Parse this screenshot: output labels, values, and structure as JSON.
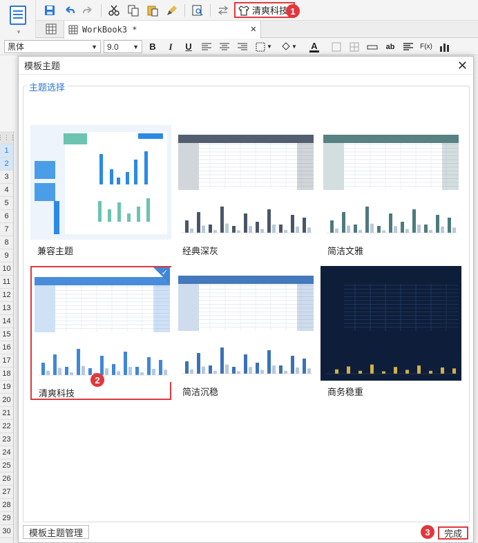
{
  "toolbar": {
    "theme_button_label": "清爽科技",
    "badge1": "1",
    "badge2": "2",
    "badge3": "3"
  },
  "tabs": {
    "workbook_tab": "WorkBook3 *"
  },
  "format_bar": {
    "font_value": "黑体",
    "size_value": "9.0",
    "bold": "B",
    "italic": "I",
    "underline": "U",
    "ab": "ab",
    "fx": "F(x)"
  },
  "rows": [
    "1",
    "2",
    "3",
    "4",
    "5",
    "6",
    "7",
    "8",
    "9",
    "10",
    "11",
    "12",
    "13",
    "14",
    "15",
    "16",
    "17",
    "18",
    "19",
    "20",
    "21",
    "22",
    "23",
    "24",
    "25",
    "26",
    "27",
    "28",
    "29",
    "30"
  ],
  "dialog": {
    "title": "模板主题",
    "group_title": "主题选择",
    "manage_button": "模板主题管理",
    "done_button": "完成",
    "themes": [
      {
        "name": "兼容主题",
        "accent": "#2b8ae6",
        "selected": false
      },
      {
        "name": "经典深灰",
        "accent": "#4a5668",
        "selected": false
      },
      {
        "name": "简洁文雅",
        "accent": "#4e7a7c",
        "selected": false
      },
      {
        "name": "清爽科技",
        "accent": "#3f86d8",
        "selected": true
      },
      {
        "name": "简洁沉稳",
        "accent": "#3a72b8",
        "selected": false
      },
      {
        "name": "商务稳重",
        "accent": "#0e1e3a",
        "selected": false
      }
    ]
  },
  "colors": {
    "highlight_red": "#e0383d",
    "primary_blue": "#2b78d6"
  }
}
